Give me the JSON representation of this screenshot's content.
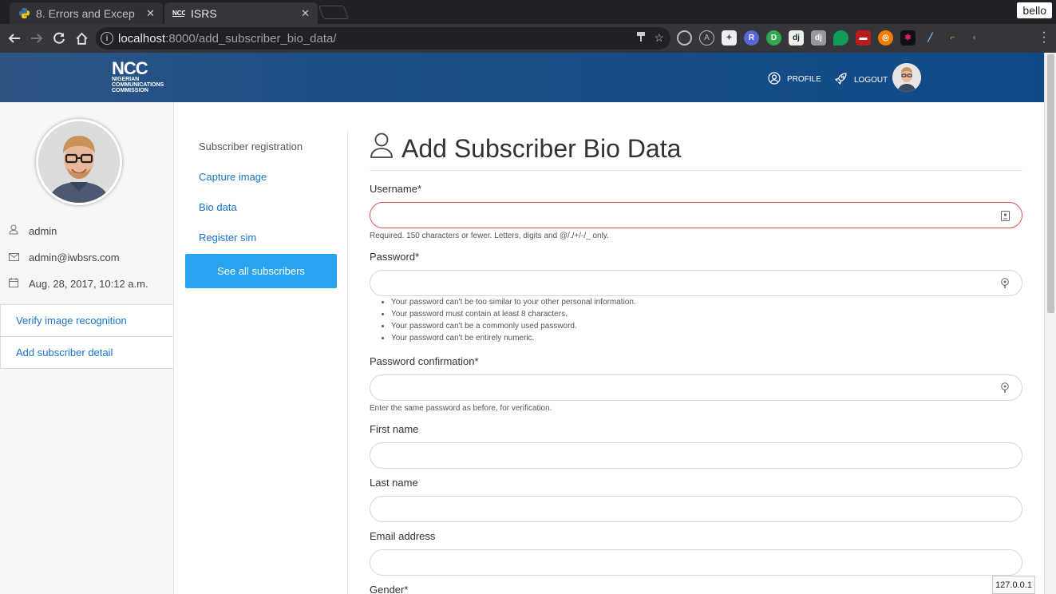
{
  "browser": {
    "tabs": [
      {
        "title": "8. Errors and Excep",
        "active": false
      },
      {
        "title": "ISRS",
        "active": true
      }
    ],
    "profile_name": "bello",
    "url_host": "localhost",
    "url_rest": ":8000/add_subscriber_bio_data/"
  },
  "header": {
    "logo_big": "NCC",
    "logo_lines": [
      "NIGERIAN",
      "COMMUNICATIONS",
      "COMMISSION"
    ],
    "profile_label": "PROFILE",
    "logout_label": "LOGOUT"
  },
  "user": {
    "name": "admin",
    "email": "admin@iwbsrs.com",
    "joined": "Aug. 28, 2017, 10:12 a.m."
  },
  "sidebar": {
    "items": [
      {
        "label": "Verify image recognition"
      },
      {
        "label": "Add subscriber detail"
      }
    ]
  },
  "subnav": {
    "heading": "Subscriber registration",
    "links": [
      {
        "label": "Capture image"
      },
      {
        "label": "Bio data"
      },
      {
        "label": "Register sim"
      }
    ],
    "button_label": "See all subscribers"
  },
  "form": {
    "title": "Add Subscriber Bio Data",
    "username_label": "Username*",
    "username_value": "",
    "username_help": "Required. 150 characters or fewer. Letters, digits and @/./+/-/_ only.",
    "password_label": "Password*",
    "password_value": "",
    "password_rules": [
      "Your password can't be too similar to your other personal information.",
      "Your password must contain at least 8 characters.",
      "Your password can't be a commonly used password.",
      "Your password can't be entirely numeric."
    ],
    "password2_label": "Password confirmation*",
    "password2_value": "",
    "password2_help": "Enter the same password as before, for verification.",
    "first_name_label": "First name",
    "first_name_value": "",
    "last_name_label": "Last name",
    "last_name_value": "",
    "email_label": "Email address",
    "email_value": "",
    "gender_label": "Gender*"
  },
  "status_bar": "127.0.0.1",
  "colors": {
    "header": "#0f4a87",
    "link": "#1a73c8",
    "button": "#29a3ef",
    "error_border": "#d9534f"
  }
}
